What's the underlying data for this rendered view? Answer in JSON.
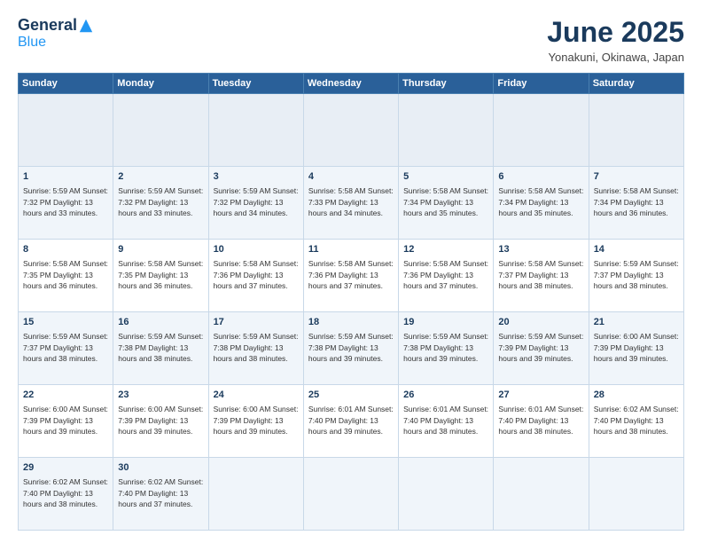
{
  "header": {
    "logo_general": "General",
    "logo_blue": "Blue",
    "month_title": "June 2025",
    "location": "Yonakuni, Okinawa, Japan"
  },
  "calendar": {
    "days_of_week": [
      "Sunday",
      "Monday",
      "Tuesday",
      "Wednesday",
      "Thursday",
      "Friday",
      "Saturday"
    ],
    "weeks": [
      [
        {
          "day": null,
          "info": null
        },
        {
          "day": null,
          "info": null
        },
        {
          "day": null,
          "info": null
        },
        {
          "day": null,
          "info": null
        },
        {
          "day": null,
          "info": null
        },
        {
          "day": null,
          "info": null
        },
        {
          "day": null,
          "info": null
        }
      ],
      [
        {
          "day": "1",
          "info": "Sunrise: 5:59 AM\nSunset: 7:32 PM\nDaylight: 13 hours\nand 33 minutes."
        },
        {
          "day": "2",
          "info": "Sunrise: 5:59 AM\nSunset: 7:32 PM\nDaylight: 13 hours\nand 33 minutes."
        },
        {
          "day": "3",
          "info": "Sunrise: 5:59 AM\nSunset: 7:32 PM\nDaylight: 13 hours\nand 34 minutes."
        },
        {
          "day": "4",
          "info": "Sunrise: 5:58 AM\nSunset: 7:33 PM\nDaylight: 13 hours\nand 34 minutes."
        },
        {
          "day": "5",
          "info": "Sunrise: 5:58 AM\nSunset: 7:34 PM\nDaylight: 13 hours\nand 35 minutes."
        },
        {
          "day": "6",
          "info": "Sunrise: 5:58 AM\nSunset: 7:34 PM\nDaylight: 13 hours\nand 35 minutes."
        },
        {
          "day": "7",
          "info": "Sunrise: 5:58 AM\nSunset: 7:34 PM\nDaylight: 13 hours\nand 36 minutes."
        }
      ],
      [
        {
          "day": "8",
          "info": "Sunrise: 5:58 AM\nSunset: 7:35 PM\nDaylight: 13 hours\nand 36 minutes."
        },
        {
          "day": "9",
          "info": "Sunrise: 5:58 AM\nSunset: 7:35 PM\nDaylight: 13 hours\nand 36 minutes."
        },
        {
          "day": "10",
          "info": "Sunrise: 5:58 AM\nSunset: 7:36 PM\nDaylight: 13 hours\nand 37 minutes."
        },
        {
          "day": "11",
          "info": "Sunrise: 5:58 AM\nSunset: 7:36 PM\nDaylight: 13 hours\nand 37 minutes."
        },
        {
          "day": "12",
          "info": "Sunrise: 5:58 AM\nSunset: 7:36 PM\nDaylight: 13 hours\nand 37 minutes."
        },
        {
          "day": "13",
          "info": "Sunrise: 5:58 AM\nSunset: 7:37 PM\nDaylight: 13 hours\nand 38 minutes."
        },
        {
          "day": "14",
          "info": "Sunrise: 5:59 AM\nSunset: 7:37 PM\nDaylight: 13 hours\nand 38 minutes."
        }
      ],
      [
        {
          "day": "15",
          "info": "Sunrise: 5:59 AM\nSunset: 7:37 PM\nDaylight: 13 hours\nand 38 minutes."
        },
        {
          "day": "16",
          "info": "Sunrise: 5:59 AM\nSunset: 7:38 PM\nDaylight: 13 hours\nand 38 minutes."
        },
        {
          "day": "17",
          "info": "Sunrise: 5:59 AM\nSunset: 7:38 PM\nDaylight: 13 hours\nand 38 minutes."
        },
        {
          "day": "18",
          "info": "Sunrise: 5:59 AM\nSunset: 7:38 PM\nDaylight: 13 hours\nand 39 minutes."
        },
        {
          "day": "19",
          "info": "Sunrise: 5:59 AM\nSunset: 7:38 PM\nDaylight: 13 hours\nand 39 minutes."
        },
        {
          "day": "20",
          "info": "Sunrise: 5:59 AM\nSunset: 7:39 PM\nDaylight: 13 hours\nand 39 minutes."
        },
        {
          "day": "21",
          "info": "Sunrise: 6:00 AM\nSunset: 7:39 PM\nDaylight: 13 hours\nand 39 minutes."
        }
      ],
      [
        {
          "day": "22",
          "info": "Sunrise: 6:00 AM\nSunset: 7:39 PM\nDaylight: 13 hours\nand 39 minutes."
        },
        {
          "day": "23",
          "info": "Sunrise: 6:00 AM\nSunset: 7:39 PM\nDaylight: 13 hours\nand 39 minutes."
        },
        {
          "day": "24",
          "info": "Sunrise: 6:00 AM\nSunset: 7:39 PM\nDaylight: 13 hours\nand 39 minutes."
        },
        {
          "day": "25",
          "info": "Sunrise: 6:01 AM\nSunset: 7:40 PM\nDaylight: 13 hours\nand 39 minutes."
        },
        {
          "day": "26",
          "info": "Sunrise: 6:01 AM\nSunset: 7:40 PM\nDaylight: 13 hours\nand 38 minutes."
        },
        {
          "day": "27",
          "info": "Sunrise: 6:01 AM\nSunset: 7:40 PM\nDaylight: 13 hours\nand 38 minutes."
        },
        {
          "day": "28",
          "info": "Sunrise: 6:02 AM\nSunset: 7:40 PM\nDaylight: 13 hours\nand 38 minutes."
        }
      ],
      [
        {
          "day": "29",
          "info": "Sunrise: 6:02 AM\nSunset: 7:40 PM\nDaylight: 13 hours\nand 38 minutes."
        },
        {
          "day": "30",
          "info": "Sunrise: 6:02 AM\nSunset: 7:40 PM\nDaylight: 13 hours\nand 37 minutes."
        },
        {
          "day": null,
          "info": null
        },
        {
          "day": null,
          "info": null
        },
        {
          "day": null,
          "info": null
        },
        {
          "day": null,
          "info": null
        },
        {
          "day": null,
          "info": null
        }
      ]
    ]
  }
}
